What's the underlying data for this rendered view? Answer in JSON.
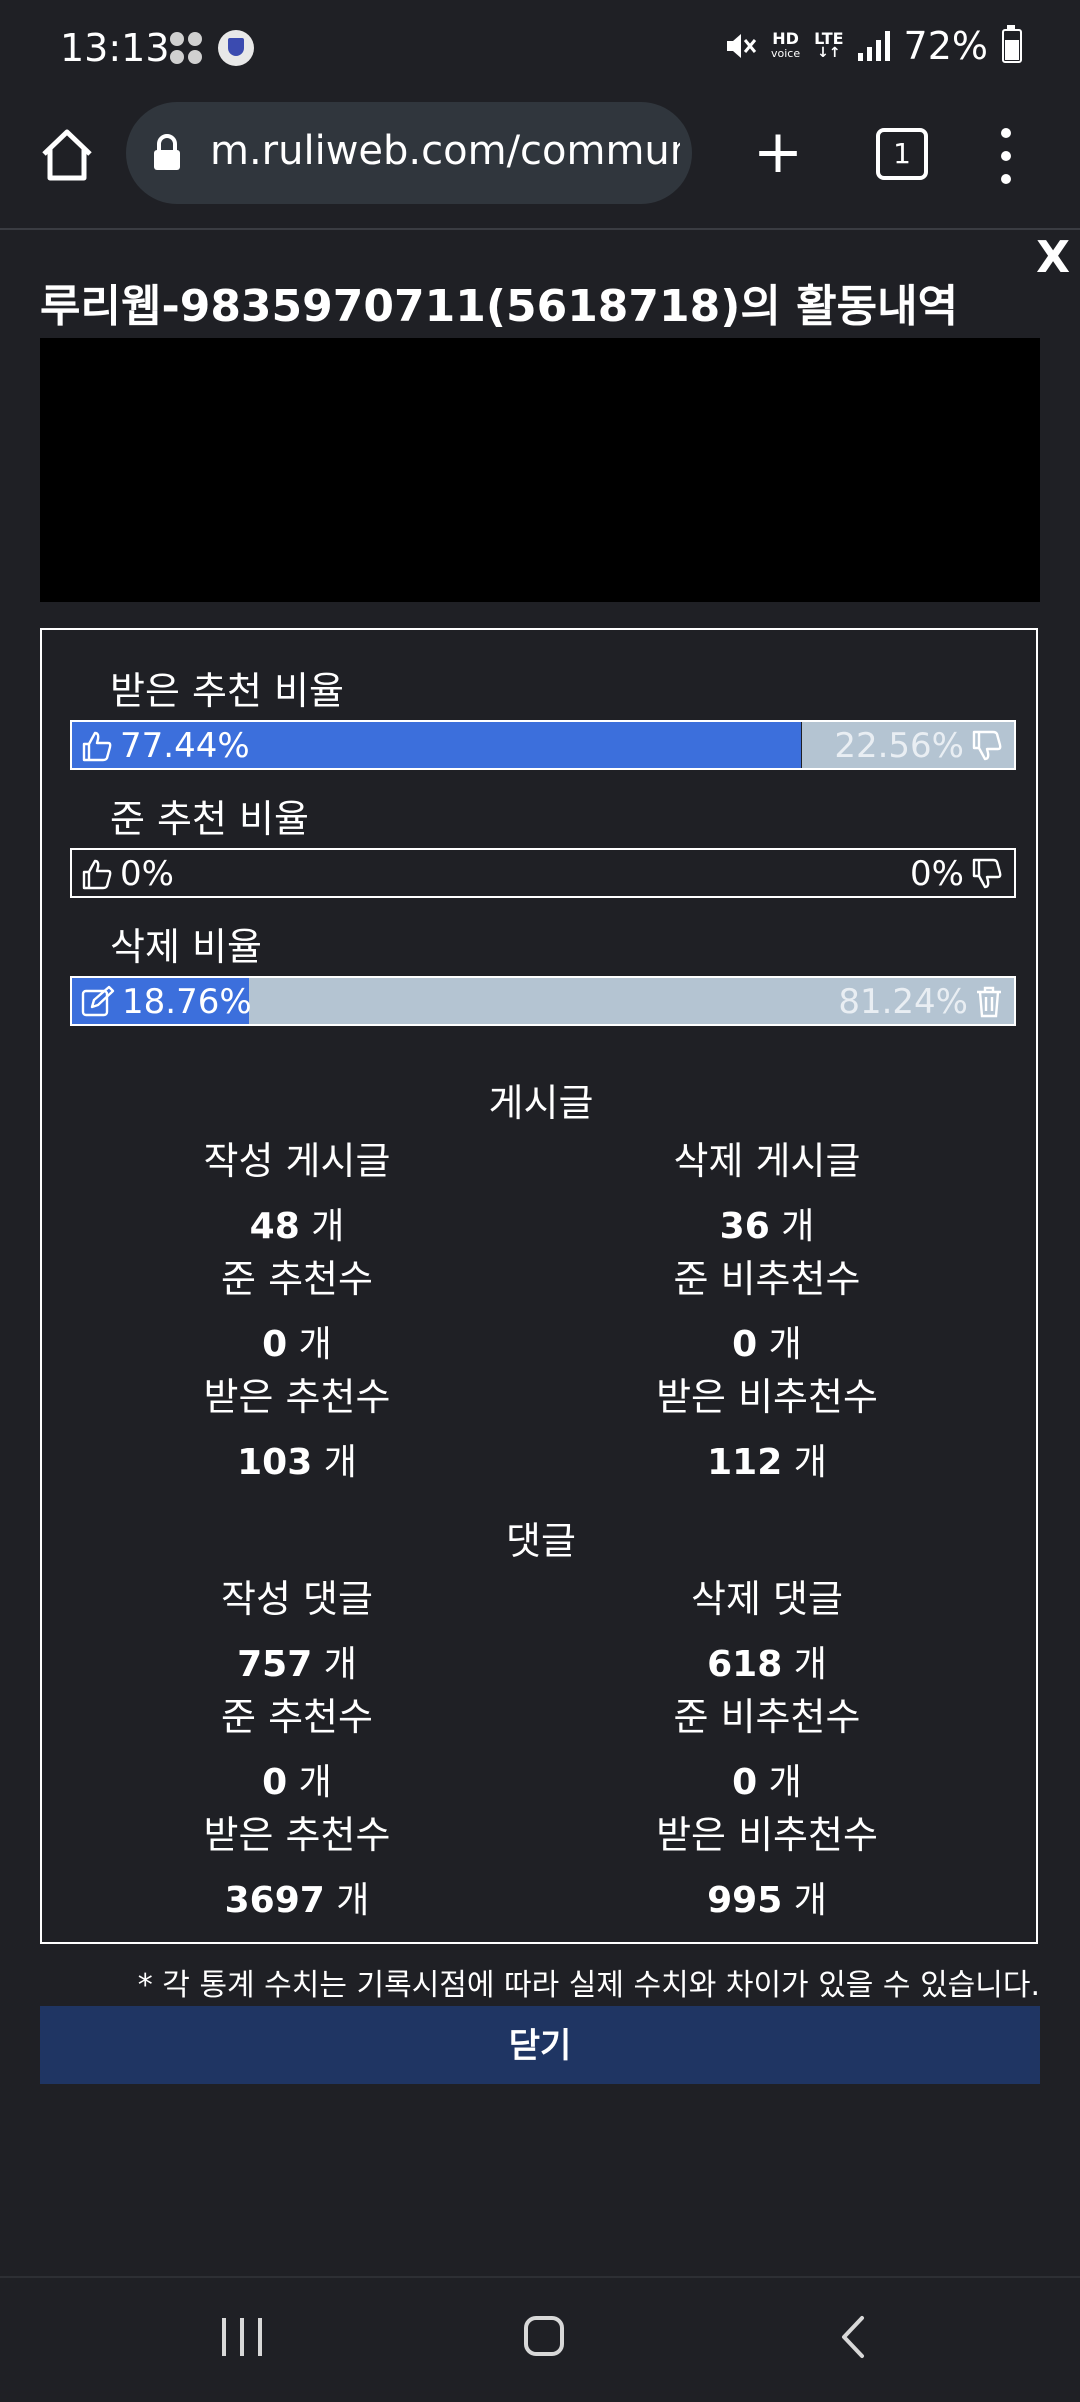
{
  "status_bar": {
    "time": "13:13",
    "hd_label": "HD",
    "voice_label": "voice",
    "lte_label": "LTE",
    "battery": "72%"
  },
  "browser": {
    "url": "m.ruliweb.com/community",
    "tab_count": "1"
  },
  "popup": {
    "close_x": "X",
    "title": "루리웹-9835970711(5618718)의 활동내역",
    "ratios": [
      {
        "label": "받은 추천 비율",
        "left": "77.44%",
        "right": "22.56%",
        "fill": 0.7744,
        "type": "recommend"
      },
      {
        "label": "준 추천 비율",
        "left": "0%",
        "right": "0%",
        "fill": 0,
        "type": "recommend"
      },
      {
        "label": "삭제 비율",
        "left": "18.76%",
        "right": "81.24%",
        "fill": 0.1876,
        "type": "delete"
      }
    ],
    "posts": {
      "title": "게시글",
      "cells": [
        {
          "label": "작성 게시글",
          "num": "48",
          "unit": " 개"
        },
        {
          "label": "삭제 게시글",
          "num": "36",
          "unit": " 개"
        },
        {
          "label": "준 추천수",
          "num": "0",
          "unit": " 개"
        },
        {
          "label": "준 비추천수",
          "num": "0",
          "unit": " 개"
        },
        {
          "label": "받은 추천수",
          "num": "103",
          "unit": " 개"
        },
        {
          "label": "받은 비추천수",
          "num": "112",
          "unit": " 개"
        }
      ]
    },
    "comments": {
      "title": "댓글",
      "cells": [
        {
          "label": "작성 댓글",
          "num": "757",
          "unit": " 개"
        },
        {
          "label": "삭제 댓글",
          "num": "618",
          "unit": " 개"
        },
        {
          "label": "준 추천수",
          "num": "0",
          "unit": " 개"
        },
        {
          "label": "준 비추천수",
          "num": "0",
          "unit": " 개"
        },
        {
          "label": "받은 추천수",
          "num": "3697",
          "unit": " 개"
        },
        {
          "label": "받은 비추천수",
          "num": "995",
          "unit": " 개"
        }
      ]
    },
    "note": "* 각 통계 수치는 기록시점에 따라 실제 수치와 차이가 있을 수 있습니다.",
    "close_button": "닫기"
  },
  "colors": {
    "accent_blue": "#3c6fdc",
    "bar_grey": "#b4c4d2",
    "close_button_bg": "#1f3563",
    "background": "#1f2025"
  },
  "icons": [
    "thumbs-up-icon",
    "thumbs-down-icon",
    "edit-icon",
    "trash-icon",
    "home-icon",
    "lock-icon"
  ]
}
